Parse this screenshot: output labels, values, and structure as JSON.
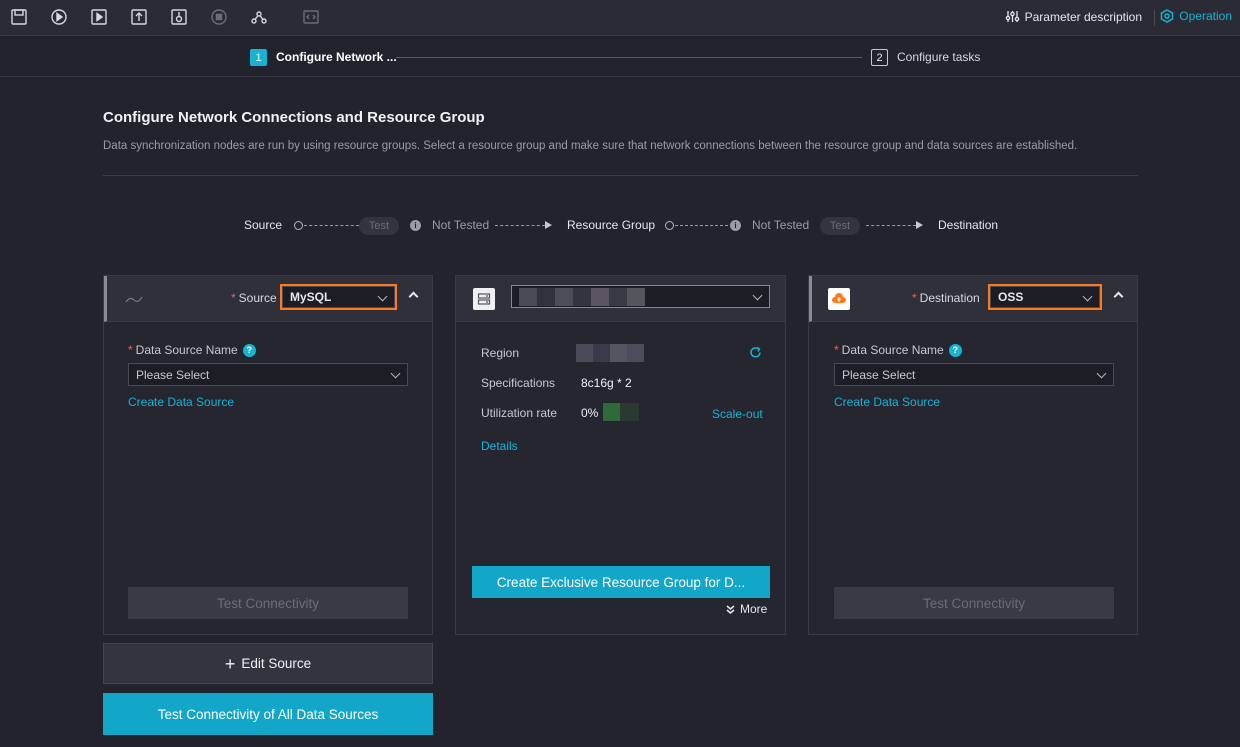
{
  "toolbar": {
    "icons": [
      "save-icon",
      "run-icon",
      "run-with-params-icon",
      "submit-icon",
      "publish-icon",
      "stop-icon",
      "lineage-icon",
      "code-view-icon"
    ],
    "param_desc": "Parameter description",
    "operation": "Operation"
  },
  "steps": {
    "step1": {
      "num": "1",
      "label": "Configure Network ..."
    },
    "step2": {
      "num": "2",
      "label": "Configure tasks"
    }
  },
  "header": {
    "title": "Configure Network Connections and Resource Group",
    "desc": "Data synchronization nodes are run by using resource groups. Select a resource group and make sure that network connections between the resource group and data sources are established."
  },
  "flow": {
    "source": "Source",
    "test1": "Test",
    "status1": "Not Tested",
    "resource_group": "Resource Group",
    "status2": "Not Tested",
    "test2": "Test",
    "destination": "Destination"
  },
  "source_card": {
    "label": "Source",
    "type": "MySQL",
    "field_label": "Data Source Name",
    "placeholder": "Please Select",
    "create_link": "Create Data Source",
    "test_btn": "Test Connectivity"
  },
  "resource_card": {
    "region_label": "Region",
    "spec_label": "Specifications",
    "spec_value": "8c16g * 2",
    "util_label": "Utilization rate",
    "util_value": "0%",
    "scale_out": "Scale-out",
    "details": "Details",
    "create_btn": "Create Exclusive Resource Group for D...",
    "more": "More"
  },
  "dest_card": {
    "label": "Destination",
    "type": "OSS",
    "field_label": "Data Source Name",
    "placeholder": "Please Select",
    "create_link": "Create Data Source",
    "test_btn": "Test Connectivity"
  },
  "actions": {
    "edit_source": "Edit Source",
    "test_all": "Test Connectivity of All Data Sources"
  },
  "colors": {
    "accent": "#17b3d4",
    "highlight": "#ff7a1a",
    "required": "#ff5a5a"
  }
}
